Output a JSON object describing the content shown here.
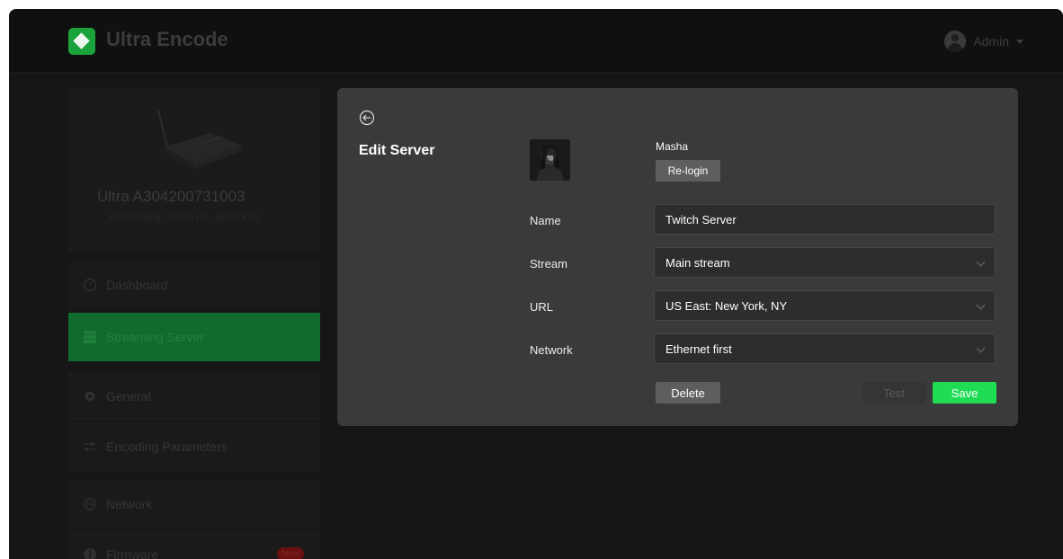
{
  "app": {
    "title": "Ultra Encode",
    "user": "Admin",
    "brand_color": "#1fdc55"
  },
  "device": {
    "name": "Ultra A304200731003",
    "spec": "1920×1080p, 59.94 Hz, 48.00 KHz"
  },
  "sidebar": {
    "items": [
      {
        "label": "Dashboard",
        "icon": "dashboard-icon"
      },
      {
        "label": "Streaming Server",
        "icon": "server-icon",
        "active": true
      },
      {
        "label": "General",
        "icon": "gear-icon"
      },
      {
        "label": "Encoding Parameters",
        "icon": "sliders-icon"
      },
      {
        "label": "Network",
        "icon": "globe-icon"
      },
      {
        "label": "Firmware",
        "icon": "info-icon",
        "badge": "New"
      }
    ]
  },
  "modal": {
    "title": "Edit Server",
    "account_name": "Masha",
    "relogin_label": "Re-login",
    "fields": {
      "name": {
        "label": "Name",
        "value": "Twitch Server"
      },
      "stream": {
        "label": "Stream",
        "value": "Main stream"
      },
      "url": {
        "label": "URL",
        "value": "US East: New York, NY"
      },
      "network": {
        "label": "Network",
        "value": "Ethernet first"
      }
    },
    "buttons": {
      "delete": "Delete",
      "test": "Test",
      "save": "Save"
    }
  }
}
